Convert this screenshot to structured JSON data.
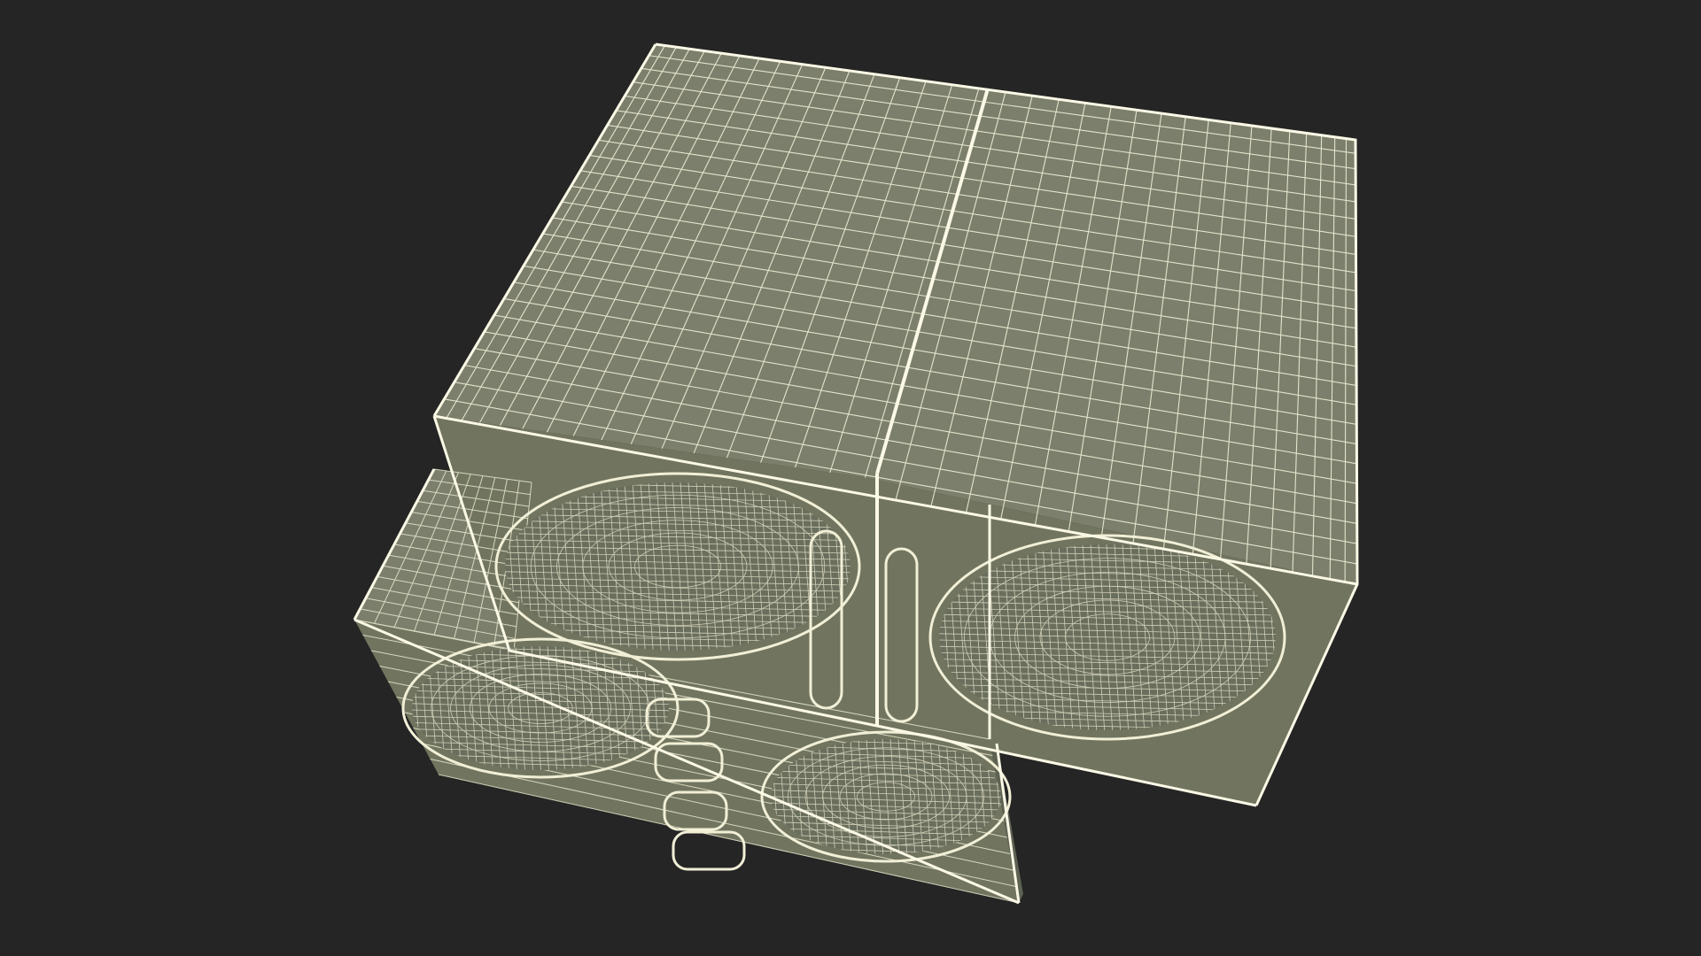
{
  "scene": {
    "subject": "speaker-box-wireframe",
    "background_color": "#252525",
    "surface_color": "#7b7f6c",
    "surface_dark_color": "#5e6252",
    "cavity_color": "#6d715f",
    "wire_color": "#f1efd6",
    "edge_color": "#fbf9e6"
  }
}
